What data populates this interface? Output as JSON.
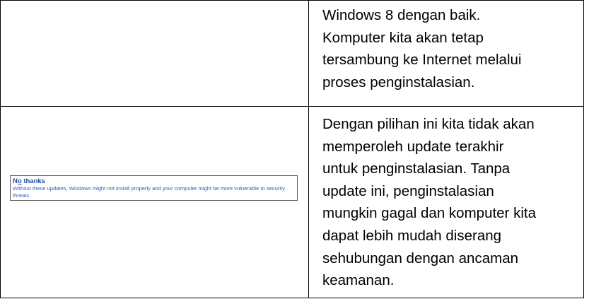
{
  "rows": [
    {
      "description": "Windows 8 dengan baik.\nKomputer kita akan tetap\ntersambung ke Internet melalui\nproses penginstalasian."
    },
    {
      "option": {
        "title_prefix": "N",
        "title_underlined": "o",
        "title_rest": " thanks",
        "description": "Without these updates, Windows might not install properly and your computer might be more vulnerable to security threats."
      },
      "description": "Dengan pilihan ini kita tidak akan\nmemperoleh update terakhir\nuntuk penginstalasian. Tanpa\nupdate ini, penginstalasian\nmungkin gagal dan komputer kita\ndapat lebih mudah diserang\nsehubungan dengan ancaman\nkeamanan."
    }
  ],
  "colors": {
    "option_title": "#1f4ea3",
    "option_text": "#2f5fb2",
    "border": "#000000"
  }
}
